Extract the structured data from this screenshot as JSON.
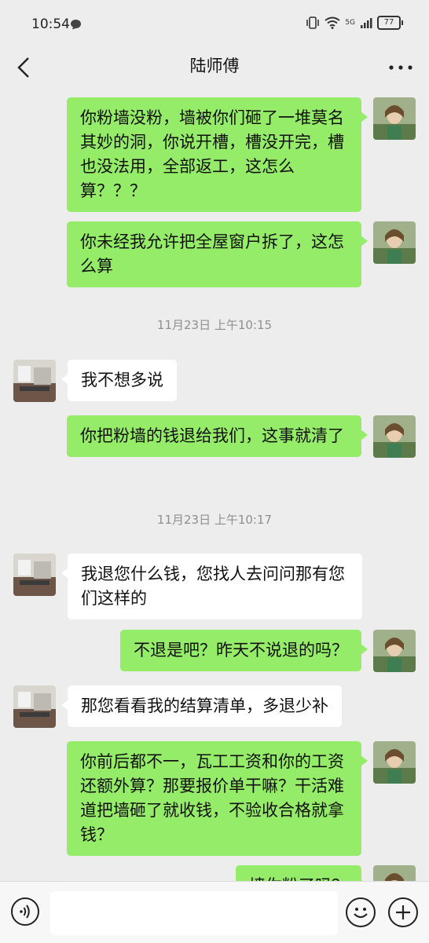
{
  "status_bar": {
    "time": "10:54",
    "network_label": "5G",
    "battery": "77"
  },
  "header": {
    "title": "陆师傅"
  },
  "messages": [
    {
      "sender": "me",
      "text": "你粉墙没粉，墙被你们砸了一堆莫名其妙的洞，你说开槽，槽没开完，槽也没法用，全部返工，这怎么算？？？"
    },
    {
      "sender": "me",
      "text": "你未经我允许把全屋窗户拆了，这怎么算"
    },
    {
      "type": "timestamp",
      "text": "11月23日 上午10:15"
    },
    {
      "sender": "them",
      "text": "我不想多说"
    },
    {
      "sender": "me",
      "text": "你把粉墙的钱退给我们，这事就清了"
    },
    {
      "type": "timestamp",
      "text": "11月23日 上午10:17"
    },
    {
      "sender": "them",
      "text": "我退您什么钱，您找人去问问那有您们这样的"
    },
    {
      "sender": "me",
      "text": "不退是吧？昨天不说退的吗？"
    },
    {
      "sender": "them",
      "text": "那您看看我的结算清单，多退少补"
    },
    {
      "sender": "me",
      "text": "你前后都不一，瓦工工资和你的工资还额外算？那要报价单干嘛？干活难道把墙砸了就收钱，不验收合格就拿钱？"
    },
    {
      "sender": "me",
      "text": "墙你粉了吗？"
    }
  ],
  "colors": {
    "my_bubble": "#95ec69",
    "their_bubble": "#ffffff",
    "background": "#ededed"
  }
}
